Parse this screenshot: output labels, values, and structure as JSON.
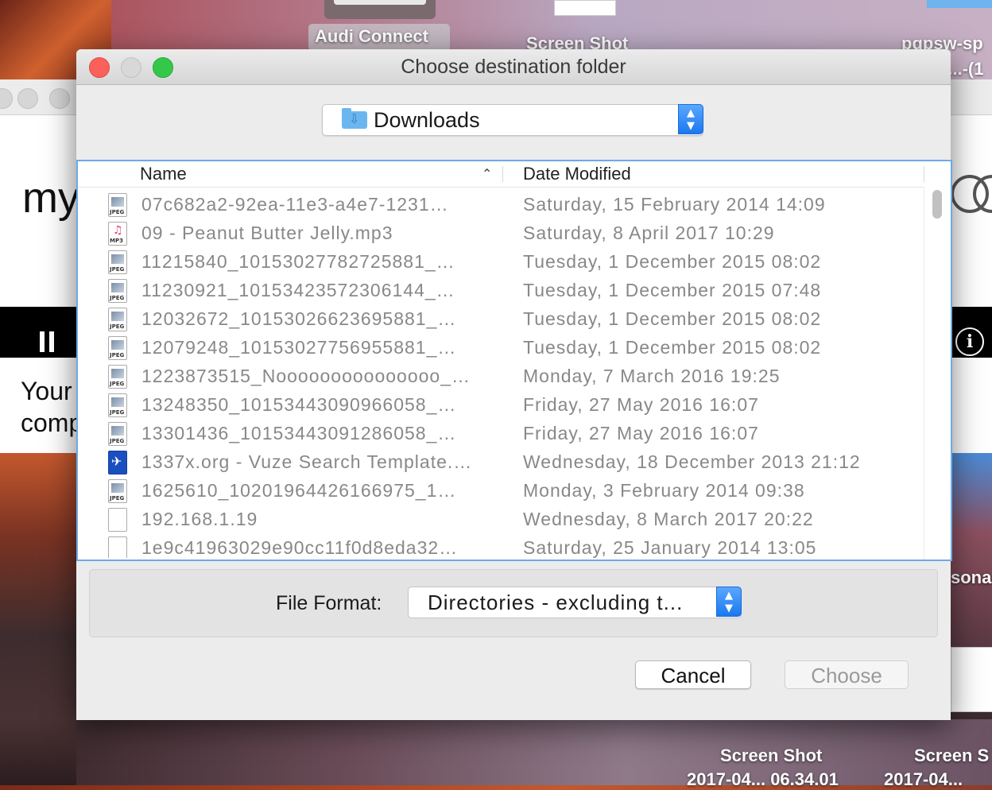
{
  "desktop": {
    "icons": [
      {
        "label": "Audi Connect"
      },
      {
        "label": "Screen Shot"
      },
      {
        "label": "pgpsw-sp"
      },
      {
        "label": "3...-(1"
      },
      {
        "label": "Screen Shot"
      },
      {
        "label": "Screen S"
      },
      {
        "label": "2017-04... 06.34.01"
      },
      {
        "label": "2017-04..."
      },
      {
        "label": "sona"
      }
    ]
  },
  "background_window": {
    "text_my": "my",
    "text_your": "Your",
    "text_comp": "comp"
  },
  "dialog": {
    "title": "Choose destination folder",
    "location": {
      "label": "Downloads",
      "icon": "downloads-folder-icon"
    },
    "columns": {
      "name": "Name",
      "date": "Date Modified",
      "sort": "ascending"
    },
    "files": [
      {
        "icon": "jpeg",
        "tag": "JPEG",
        "name": "07c682a2-92ea-11e3-a4e7-1231…",
        "date": "Saturday, 15 February 2014 14:09"
      },
      {
        "icon": "mp3",
        "tag": "MP3",
        "name": "09 - Peanut Butter Jelly.mp3",
        "date": "Saturday, 8 April 2017 10:29"
      },
      {
        "icon": "jpeg",
        "tag": "JPEG",
        "name": "11215840_10153027782725881_…",
        "date": "Tuesday, 1 December 2015 08:02"
      },
      {
        "icon": "jpeg",
        "tag": "JPEG",
        "name": "11230921_10153423572306144_…",
        "date": "Tuesday, 1 December 2015 07:48"
      },
      {
        "icon": "jpeg",
        "tag": "JPEG",
        "name": "12032672_10153026623695881_…",
        "date": "Tuesday, 1 December 2015 08:02"
      },
      {
        "icon": "jpeg",
        "tag": "JPEG",
        "name": "12079248_10153027756955881_…",
        "date": "Tuesday, 1 December 2015 08:02"
      },
      {
        "icon": "jpeg",
        "tag": "JPEG",
        "name": "1223873515_Nooooooooooooooo_…",
        "date": "Monday, 7 March 2016 19:25"
      },
      {
        "icon": "jpeg",
        "tag": "JPEG",
        "name": "13248350_10153443090966058_…",
        "date": "Friday, 27 May 2016 16:07"
      },
      {
        "icon": "jpeg",
        "tag": "JPEG",
        "name": "13301436_10153443091286058_…",
        "date": "Friday, 27 May 2016 16:07"
      },
      {
        "icon": "vuze",
        "tag": "",
        "name": "1337x.org - Vuze Search Template.…",
        "date": "Wednesday, 18 December 2013 21:12"
      },
      {
        "icon": "jpeg",
        "tag": "JPEG",
        "name": "1625610_10201964426166975_1…",
        "date": "Monday, 3 February 2014 09:38"
      },
      {
        "icon": "blank",
        "tag": "",
        "name": "192.168.1.19",
        "date": "Wednesday, 8 March 2017 20:22"
      },
      {
        "icon": "blank",
        "tag": "",
        "name": "1e9c41963029e90cc11f0d8eda32…",
        "date": "Saturday, 25 January 2014 13:05"
      }
    ],
    "file_format": {
      "label": "File Format:",
      "value": "Directories - excluding t..."
    },
    "buttons": {
      "cancel": "Cancel",
      "choose": "Choose"
    }
  }
}
